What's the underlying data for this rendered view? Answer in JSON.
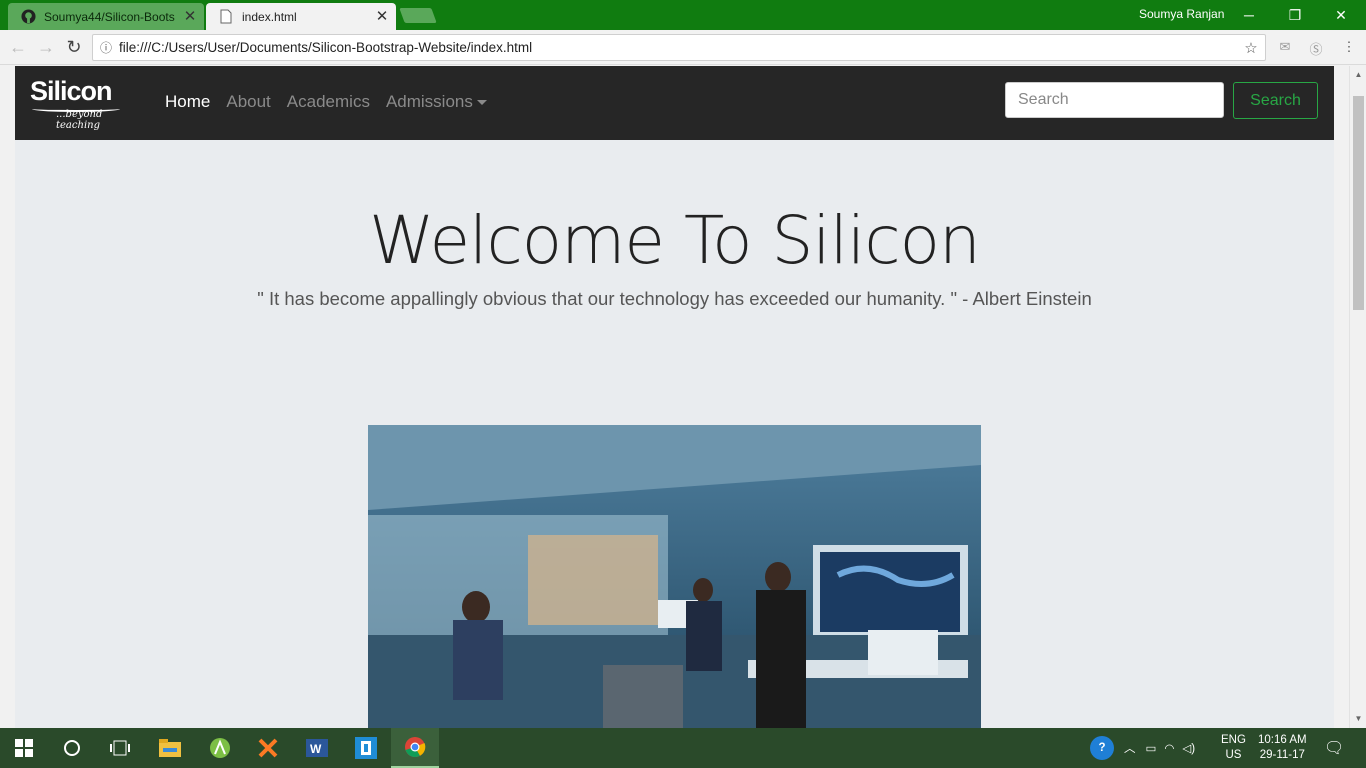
{
  "browser": {
    "tabs": [
      {
        "label": "Soumya44/Silicon-Boots",
        "icon": "github-icon"
      },
      {
        "label": "index.html",
        "icon": "page-icon"
      }
    ],
    "profile": "Soumya Ranjan",
    "url": "file:///C:/Users/User/Documents/Silicon-Bootstrap-Website/index.html"
  },
  "site": {
    "logo_title": "Silicon",
    "logo_tagline": "...beyond teaching",
    "nav": [
      "Home",
      "About",
      "Academics",
      "Admissions"
    ],
    "search_placeholder": "Search",
    "search_button": "Search",
    "headline": "Welcome To Silicon",
    "quote": "\" It has become appallingly obvious that our technology has exceeded our humanity. \" - Albert Einstein"
  },
  "taskbar": {
    "lang_top": "ENG",
    "lang_bottom": "US",
    "time": "10:16 AM",
    "date": "29-11-17"
  },
  "colors": {
    "titlebar": "#107c10",
    "navbar": "#262626",
    "jumbotron": "#e9ecef",
    "success": "#28a745"
  }
}
